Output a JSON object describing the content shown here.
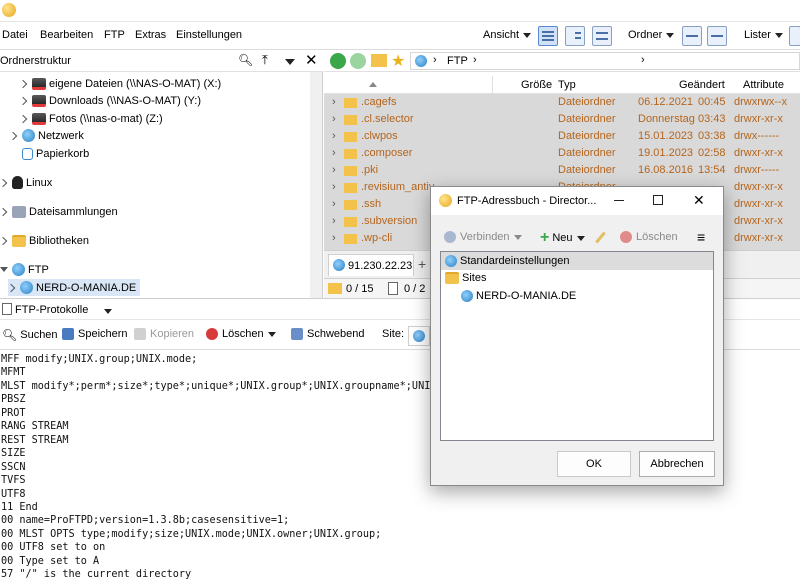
{
  "menubar": {
    "items": [
      "Datei",
      "Bearbeiten",
      "FTP",
      "Extras",
      "Einstellungen"
    ],
    "ansicht": "Ansicht",
    "ordner": "Ordner",
    "lister": "Lister"
  },
  "left_pane": {
    "header": "Ordnerstruktur",
    "tree": [
      "eigene Dateien (\\\\NAS-O-MAT) (X:)",
      "Downloads (\\\\NAS-O-MAT) (Y:)",
      "Fotos (\\\\nas-o-mat) (Z:)",
      "Netzwerk",
      "Papierkorb",
      "Linux",
      "Dateisammlungen",
      "Bibliotheken",
      "FTP",
      "NERD-O-MANIA.DE"
    ]
  },
  "right_pane": {
    "path": [
      "FTP"
    ],
    "columns": {
      "size": "Größe",
      "type": "Typ",
      "changed": "Geändert",
      "attributes": "Attribute"
    },
    "rows": [
      {
        "name": ".cagefs",
        "type": "Dateiordner",
        "date": "06.12.2021",
        "time": "00:45",
        "attr": "drwxrwx--x"
      },
      {
        "name": ".cl.selector",
        "type": "Dateiordner",
        "date": "Donnerstag",
        "time": "03:43",
        "attr": "drwxr-xr-x"
      },
      {
        "name": ".clwpos",
        "type": "Dateiordner",
        "date": "15.01.2023",
        "time": "03:38",
        "attr": "drwx------"
      },
      {
        "name": ".composer",
        "type": "Dateiordner",
        "date": "19.01.2023",
        "time": "02:58",
        "attr": "drwxr-xr-x"
      },
      {
        "name": ".pki",
        "type": "Dateiordner",
        "date": "16.08.2016",
        "time": "13:54",
        "attr": "drwxr-----"
      },
      {
        "name": ".revisium_antiv",
        "type": "Dateiordner",
        "date": "",
        "time": "",
        "attr": "drwxr-xr-x"
      },
      {
        "name": ".ssh",
        "type": "",
        "date": "",
        "time": "",
        "attr": "drwxr-xr-x"
      },
      {
        "name": ".subversion",
        "type": "",
        "date": "",
        "time": "",
        "attr": "drwxr-xr-x"
      },
      {
        "name": ".wp-cli",
        "type": "",
        "date": "",
        "time": "",
        "attr": "drwxr-xr-x"
      }
    ],
    "tab_label": "91.230.22.23",
    "status_folders": "0 / 15",
    "status_files": "0 / 2"
  },
  "protocol": {
    "title": "FTP-Protokolle",
    "tools": {
      "search": "Suchen",
      "save": "Speichern",
      "copy": "Kopieren",
      "delete": "Löschen",
      "float": "Schwebend",
      "site": "Site:"
    },
    "lines": [
      "MFF modify;UNIX.group;UNIX.mode;",
      "MFMT",
      "MLST modify*;perm*;size*;type*;unique*;UNIX.group*;UNIX.groupname*;UNIX",
      "PBSZ",
      "PROT",
      "RANG STREAM",
      "REST STREAM",
      "SIZE",
      "SSCN",
      "TVFS",
      "UTF8",
      "11 End",
      "00 name=ProFTPD;version=1.3.8b;casesensitive=1;",
      "00 MLST OPTS type;modify;size;UNIX.mode;UNIX.owner;UNIX.group;",
      "00 UTF8 set to on",
      "00 Type set to A",
      "57 \"/\" is the current directory"
    ]
  },
  "dialog": {
    "title": "FTP-Adressbuch - Director...",
    "toolbar": {
      "connect": "Verbinden",
      "new": "Neu",
      "delete": "Löschen"
    },
    "tree": [
      "Standardeinstellungen",
      "Sites",
      "NERD-O-MANIA.DE"
    ],
    "ok": "OK",
    "cancel": "Abbrechen"
  }
}
